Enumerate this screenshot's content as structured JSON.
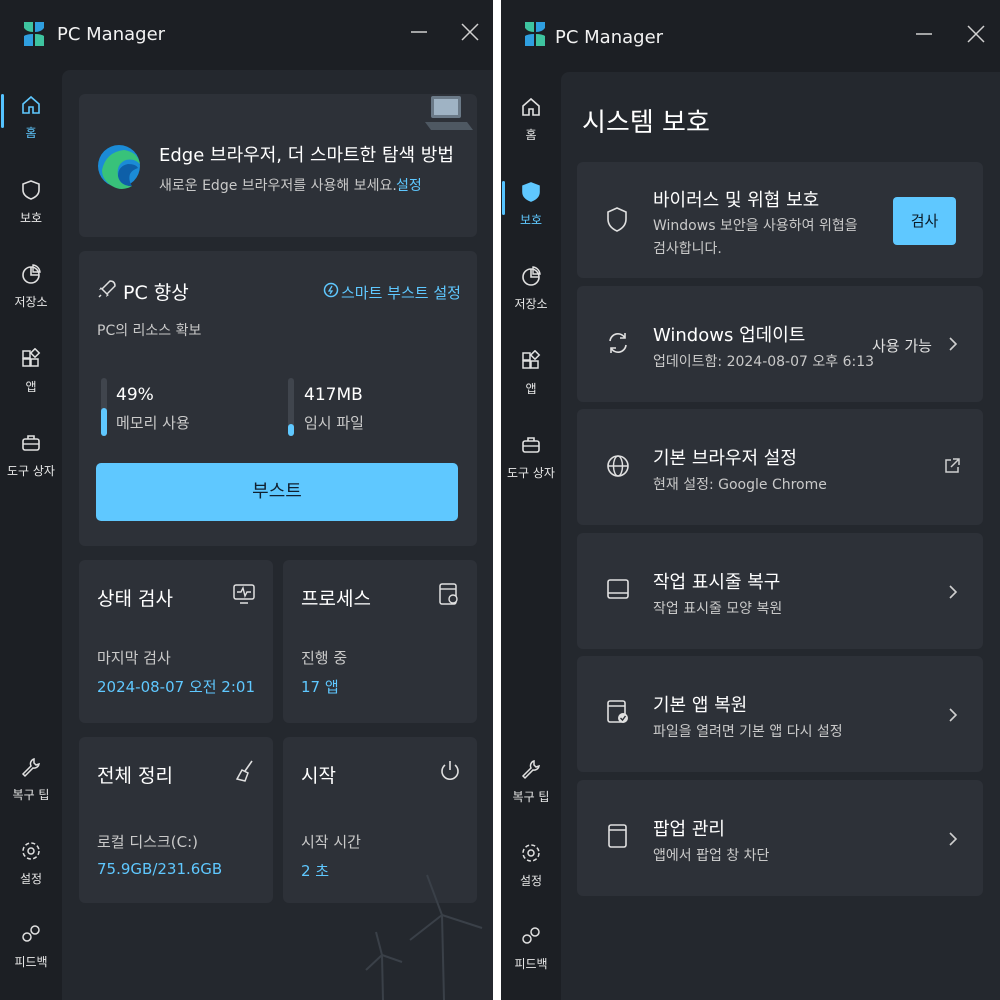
{
  "left_window": {
    "title": "PC Manager",
    "nav": [
      {
        "label": "홈",
        "icon": "home-icon",
        "active": true
      },
      {
        "label": "보호",
        "icon": "shield-icon",
        "active": false
      },
      {
        "label": "저장소",
        "icon": "pie-chart-icon",
        "active": false
      },
      {
        "label": "앱",
        "icon": "apps-icon",
        "active": false
      },
      {
        "label": "도구 상자",
        "icon": "toolbox-icon",
        "active": false
      }
    ],
    "nav_bottom": [
      {
        "label": "복구 팁",
        "icon": "wrench-icon"
      },
      {
        "label": "설정",
        "icon": "gear-icon"
      },
      {
        "label": "피드백",
        "icon": "feedback-icon"
      }
    ],
    "edge_banner": {
      "title": "Edge 브라우저, 더 스마트한 탐색 방법",
      "subtitle": "새로운 Edge 브라우저를 사용해 보세요.",
      "link": "설정"
    },
    "boost": {
      "title": "PC 향상",
      "smart_link": "스마트 부스트 설정",
      "subtitle": "PC의 리소스 확보",
      "memory_value": "49%",
      "memory_label": "메모리 사용",
      "memory_level": 0.49,
      "temp_value": "417MB",
      "temp_label": "임시 파일",
      "temp_level": 0.2,
      "button": "부스트"
    },
    "health": {
      "title": "상태 검사",
      "label": "마지막 검사",
      "value": "2024-08-07 오전 2:01"
    },
    "process": {
      "title": "프로세스",
      "label": "진행 중",
      "value": "17 앱"
    },
    "cleanup": {
      "title": "전체 정리",
      "label": "로컬 디스크(C:)",
      "value": "75.9GB/231.6GB"
    },
    "startup": {
      "title": "시작",
      "label": "시작 시간",
      "value": "2 초"
    }
  },
  "right_window": {
    "title": "PC Manager",
    "page_title": "시스템 보호",
    "nav": [
      {
        "label": "홈",
        "icon": "home-icon",
        "active": false
      },
      {
        "label": "보호",
        "icon": "shield-icon",
        "active": true
      },
      {
        "label": "저장소",
        "icon": "pie-chart-icon",
        "active": false
      },
      {
        "label": "앱",
        "icon": "apps-icon",
        "active": false
      },
      {
        "label": "도구 상자",
        "icon": "toolbox-icon",
        "active": false
      }
    ],
    "nav_bottom": [
      {
        "label": "복구 팁",
        "icon": "wrench-icon"
      },
      {
        "label": "설정",
        "icon": "gear-icon"
      },
      {
        "label": "피드백",
        "icon": "feedback-icon"
      }
    ],
    "items": [
      {
        "title": "바이러스 및 위협 보호",
        "subtitle_1": "Windows 보안을 사용하여 위협을",
        "subtitle_2": "검사합니다.",
        "button": "검사"
      },
      {
        "title": "Windows 업데이트",
        "subtitle": "업데이트함: 2024-08-07 오후 6:13",
        "status": "사용 가능"
      },
      {
        "title": "기본 브라우저 설정",
        "subtitle": "현재 설정: Google Chrome"
      },
      {
        "title": "작업 표시줄 복구",
        "subtitle": "작업 표시줄 모양 복원"
      },
      {
        "title": "기본 앱 복원",
        "subtitle": "파일을 열려면 기본 앱 다시 설정"
      },
      {
        "title": "팝업 관리",
        "subtitle": "앱에서 팝업 창 차단"
      }
    ]
  },
  "colors": {
    "accent": "#5fc8ff",
    "window_bg": "#1c1f24",
    "content_bg": "#24282e",
    "card_bg": "#2d3138"
  }
}
